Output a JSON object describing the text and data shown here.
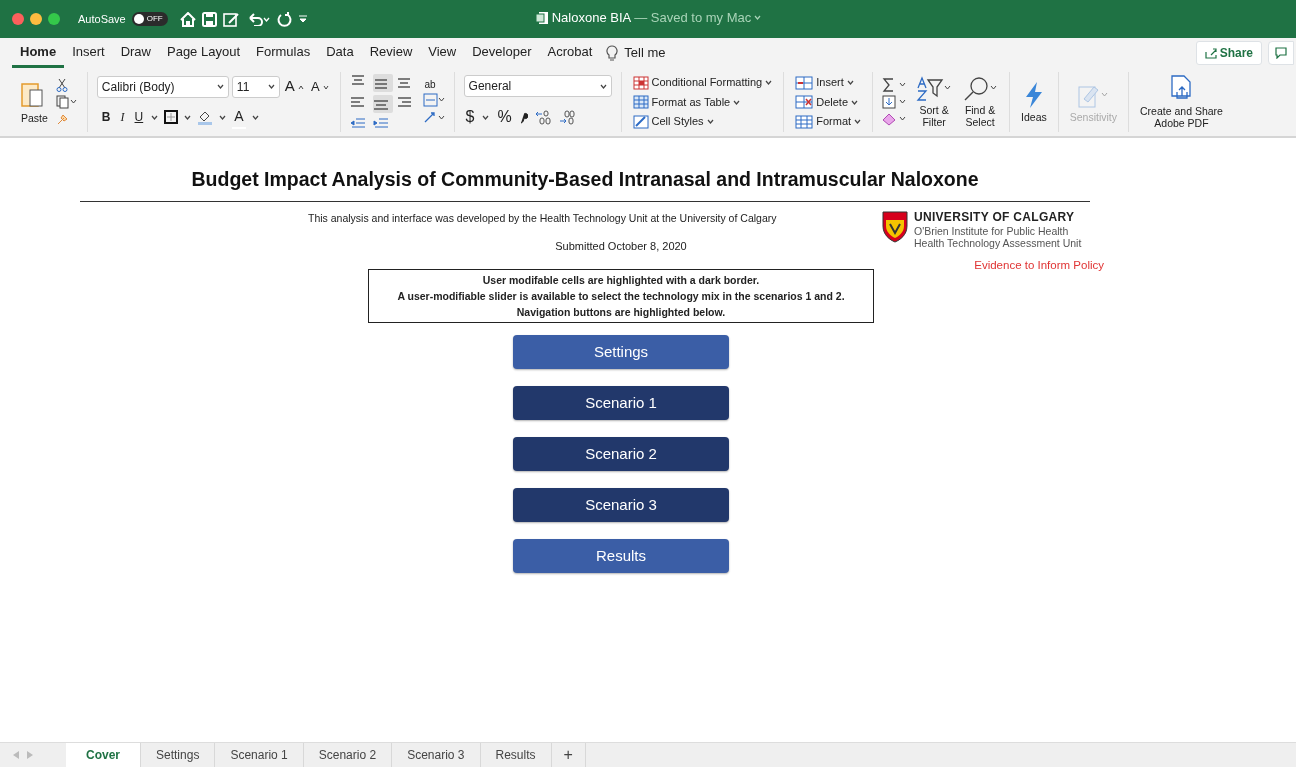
{
  "window": {
    "title": "Naloxone BIA",
    "save_status": "— Saved to my Mac",
    "autosave_label": "AutoSave",
    "autosave": {
      "on": false,
      "label": "OFF"
    }
  },
  "ribbon_tabs": [
    {
      "label": "Home",
      "selected": true
    },
    {
      "label": "Insert",
      "selected": false
    },
    {
      "label": "Draw",
      "selected": false
    },
    {
      "label": "Page Layout",
      "selected": false
    },
    {
      "label": "Formulas",
      "selected": false
    },
    {
      "label": "Data",
      "selected": false
    },
    {
      "label": "Review",
      "selected": false
    },
    {
      "label": "View",
      "selected": false
    },
    {
      "label": "Developer",
      "selected": false
    },
    {
      "label": "Acrobat",
      "selected": false
    }
  ],
  "tell_me": "Tell me",
  "share": "Share",
  "ribbon": {
    "paste": "Paste",
    "font_name": "Calibri (Body)",
    "font_size": "11",
    "grow": "A",
    "shrink": "A",
    "bold": "B",
    "italic": "I",
    "underline": "U",
    "font_color": "A",
    "wrap": "ab",
    "number_format": "General",
    "currency": "$",
    "percent": "%",
    "styles": [
      "Conditional Formatting",
      "Format as Table",
      "Cell Styles"
    ],
    "cells": [
      "Insert",
      "Delete",
      "Format"
    ],
    "sort": [
      "Sort &",
      "Filter"
    ],
    "find": [
      "Find &",
      "Select"
    ],
    "ideas": "Ideas",
    "sensitivity": {
      "label": "Sensitivity",
      "disabled": true
    },
    "adobe": [
      "Create and Share",
      "Adobe PDF"
    ]
  },
  "sheet": {
    "heading": "Budget Impact Analysis of Community-Based Intranasal and Intramuscular Naloxone",
    "credit": "This analysis and interface was developed by the Health Technology Unit at the University of Calgary",
    "submitted": "Submitted October 8, 2020",
    "notice": [
      "User modifable cells are highlighted with a dark border.",
      "A user-modifiable slider is available to select the technology mix in the scenarios 1 and 2.",
      "Navigation buttons are highlighted below."
    ],
    "logo": {
      "name": "UNIVERSITY OF CALGARY",
      "lines": [
        "O'Brien Institute for Public Health",
        "Health Technology Assessment Unit"
      ]
    },
    "tagline": "Evidence to Inform Policy",
    "nav_buttons": [
      {
        "label": "Settings",
        "color": "#3b5ea6"
      },
      {
        "label": "Scenario 1",
        "color": "#22386b"
      },
      {
        "label": "Scenario 2",
        "color": "#22386b"
      },
      {
        "label": "Scenario 3",
        "color": "#22386b"
      },
      {
        "label": "Results",
        "color": "#3b5ea6"
      }
    ]
  },
  "sheet_tabs": [
    {
      "label": "Cover",
      "selected": true
    },
    {
      "label": "Settings",
      "selected": false
    },
    {
      "label": "Scenario 1",
      "selected": false
    },
    {
      "label": "Scenario 2",
      "selected": false
    },
    {
      "label": "Scenario 3",
      "selected": false
    },
    {
      "label": "Results",
      "selected": false
    }
  ],
  "add_sheet": "+"
}
